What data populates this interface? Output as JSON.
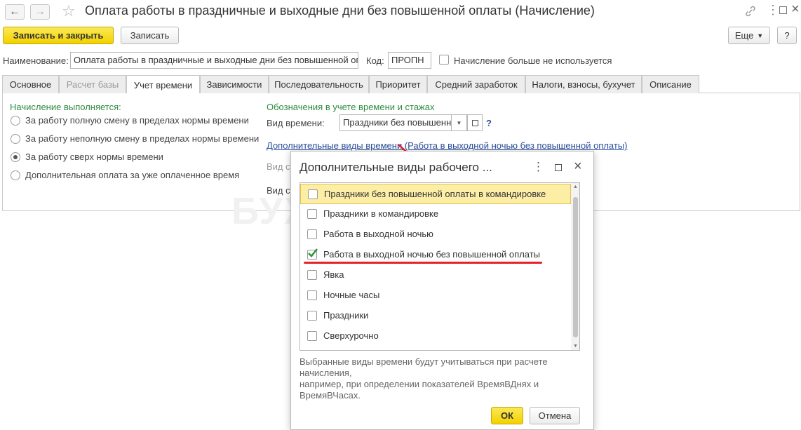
{
  "window": {
    "title": "Оплата работы в праздничные и выходные дни без повышенной оплаты (Начисление)"
  },
  "toolbar": {
    "save_close_label": "Записать и закрыть",
    "save_label": "Записать",
    "more_label": "Еще",
    "help_label": "?"
  },
  "form": {
    "name_label": "Наименование:",
    "name_value": "Оплата работы в праздничные и выходные дни без повышенной оплаты",
    "code_label": "Код:",
    "code_value": "ПРОПН",
    "unused_label": "Начисление больше не используется"
  },
  "tabs": [
    {
      "label": "Основное"
    },
    {
      "label": "Расчет базы"
    },
    {
      "label": "Учет времени"
    },
    {
      "label": "Зависимости"
    },
    {
      "label": "Последовательность"
    },
    {
      "label": "Приоритет"
    },
    {
      "label": "Средний заработок"
    },
    {
      "label": "Налоги, взносы, бухучет"
    },
    {
      "label": "Описание"
    }
  ],
  "time_tab": {
    "left_heading": "Начисление выполняется:",
    "options": [
      {
        "label": "За работу полную смену в пределах нормы времени"
      },
      {
        "label": "За работу неполную смену в пределах нормы времени"
      },
      {
        "label": "За работу сверх нормы времени"
      },
      {
        "label": "Дополнительная оплата за уже оплаченное время"
      }
    ],
    "right_heading": "Обозначения в учете времени и стажах",
    "time_type_label": "Вид времени:",
    "time_type_value": "Праздники без повышенн",
    "help_mark": "?",
    "extra_link": "Дополнительные виды времени (Работа в выходной ночью без повышенной оплаты)",
    "hidden_label_1": "Вид с",
    "hidden_label_2": "Вид с"
  },
  "watermark": "БУХЭКСПЕРТ",
  "dialog": {
    "title": "Дополнительные виды рабочего ...",
    "items": [
      {
        "label": "Праздники без повышенной оплаты в командировке",
        "checked": false
      },
      {
        "label": "Праздники в командировке",
        "checked": false
      },
      {
        "label": "Работа в выходной ночью",
        "checked": false
      },
      {
        "label": "Работа в выходной ночью без повышенной оплаты",
        "checked": true
      },
      {
        "label": "Явка",
        "checked": false
      },
      {
        "label": "Ночные часы",
        "checked": false
      },
      {
        "label": "Праздники",
        "checked": false
      },
      {
        "label": "Сверхурочно",
        "checked": false
      }
    ],
    "hint_lines": [
      "Выбранные виды времени будут учитываться при расчете",
      "начисления,",
      "например, при определении показателей ВремяВДнях и",
      "ВремяВЧасах."
    ],
    "ok_label": "ОК",
    "cancel_label": "Отмена"
  },
  "colors": {
    "accent_yellow": "#f3d200",
    "heading_green": "#2e8b3f",
    "link_blue": "#2b4f9e",
    "annotation_red": "#e8202a"
  }
}
